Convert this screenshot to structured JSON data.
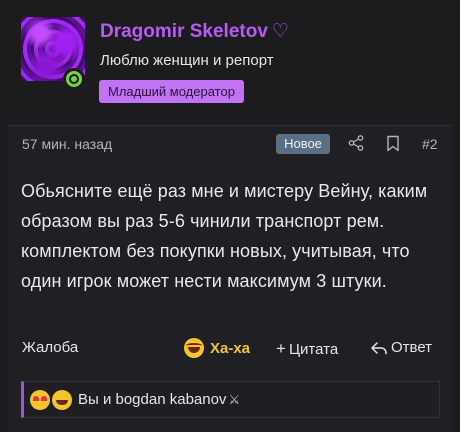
{
  "user": {
    "name": "Dragomir Skeletov",
    "heart": "♡",
    "title": "Люблю женщин и репорт",
    "role": "Младший модератор",
    "name_color": "#b65cf2",
    "role_bg": "#c173f5",
    "status": "online"
  },
  "post": {
    "time": "57 мин. назад",
    "new_badge": "Новое",
    "number": "#2",
    "body": "Обьясните ещё раз мне и мистеру Вейну, каким образом вы раз 5-6 чинили транспорт рем. комплектом без покупки новых, учитывая, что один игрок может нести максимум 3 штуки."
  },
  "actions": {
    "report": "Жалоба",
    "haha": "Ха-ха",
    "quote_plus": "+",
    "quote": "Цитата",
    "reply": "Ответ"
  },
  "reactions": {
    "emojis": [
      "heart-eyes",
      "rolling-laugh"
    ],
    "text": "Вы и bogdan kabanov",
    "suffix_icon": "crossed-swords"
  },
  "icons": [
    "share-icon",
    "bookmark-icon",
    "reply-icon",
    "laugh-emoji-icon"
  ]
}
